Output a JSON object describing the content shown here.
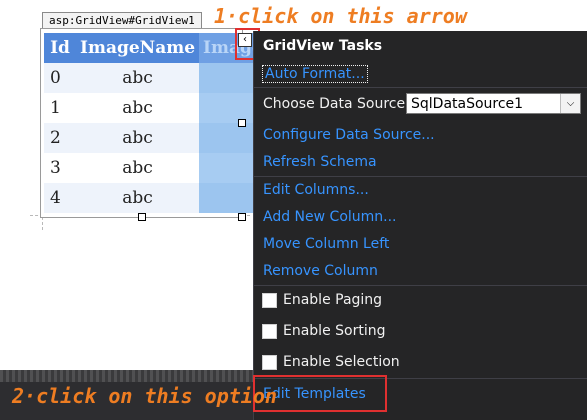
{
  "designer": {
    "tag_label": "asp:GridView#GridView1",
    "smart_tag_glyph": "‹"
  },
  "grid": {
    "headers": [
      "Id",
      "ImageName",
      "Image"
    ],
    "rows": [
      {
        "id": "0",
        "name": "abc"
      },
      {
        "id": "1",
        "name": "abc"
      },
      {
        "id": "2",
        "name": "abc"
      },
      {
        "id": "3",
        "name": "abc"
      },
      {
        "id": "4",
        "name": "abc"
      }
    ]
  },
  "annotations": {
    "step1": "1·click on this arrow",
    "step2": "2·click on this option"
  },
  "tasks": {
    "title": "GridView Tasks",
    "auto_format": "Auto Format...",
    "choose_data_source_label": "Choose Data Source:",
    "data_source_value": "SqlDataSource1",
    "configure_data_source": "Configure Data Source...",
    "refresh_schema": "Refresh Schema",
    "edit_columns": "Edit Columns...",
    "add_new_column": "Add New Column...",
    "move_column_left": "Move Column Left",
    "remove_column": "Remove Column",
    "enable_paging": "Enable Paging",
    "enable_sorting": "Enable Sorting",
    "enable_selection": "Enable Selection",
    "edit_templates": "Edit Templates"
  },
  "colors": {
    "link": "#3794ff",
    "panel_bg": "#252526",
    "annotation_orange": "#ee7d22",
    "annotation_red": "#e03030",
    "grid_header": "#4f86d9"
  }
}
